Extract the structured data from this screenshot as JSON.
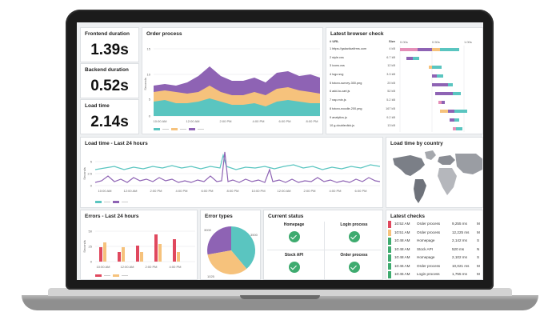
{
  "colors": {
    "teal": "#5ac5c0",
    "orange": "#f6c27c",
    "purple": "#8e63b4",
    "red": "#e0485e",
    "green": "#3eab6f",
    "pink": "#e58fb8",
    "gray": "#a5a8ad"
  },
  "kpis": [
    {
      "label": "Frontend duration",
      "value": "1.39s"
    },
    {
      "label": "Backend duration",
      "value": "0.52s"
    },
    {
      "label": "Load time",
      "value": "2.14s"
    }
  ],
  "order_process": {
    "title": "Order process",
    "ylabel": "Seconds",
    "yticks": [
      "15",
      "10",
      "5",
      "0"
    ],
    "xticks": [
      "10:00 AM",
      "12:00 AM",
      "2:00 PM",
      "4:00 PM",
      "6:00 PM",
      "8:00 PM"
    ]
  },
  "browser_check": {
    "title": "Latest browser check",
    "header": {
      "url": "# URL",
      "size": "Size",
      "t0": "0.00s",
      "t1": "0.50s",
      "t2": "1.00s"
    },
    "rows": [
      {
        "url": "1  https://galacticafirms.com",
        "size": "4 kB"
      },
      {
        "url": "2  style.css",
        "size": "6.7 kB"
      },
      {
        "url": "3  icons.css",
        "size": "12 kB"
      },
      {
        "url": "4  logo.svg",
        "size": "3.3 kB"
      },
      {
        "url": "5  totoro-survey-300.png",
        "size": "20 kB"
      },
      {
        "url": "6  add-to-cart.js",
        "size": "52 kB"
      },
      {
        "url": "7  nap.min.js",
        "size": "5.2 kB"
      },
      {
        "url": "8  totoro-noodle-200.png",
        "size": "167 kB"
      },
      {
        "url": "9  analytics.js",
        "size": "9.2 kB"
      },
      {
        "url": "10  g.doubleclick.js",
        "size": "13 kB"
      }
    ]
  },
  "load_time": {
    "title": "Load time - Last 24 hours",
    "ylabel": "Seconds",
    "yticks": [
      "5",
      "2.5",
      "0"
    ],
    "xticks": [
      "10:00 AM",
      "12:00 AM",
      "2:00 PM",
      "4:00 PM",
      "6:00 PM",
      "8:00 PM",
      "10:00 PM",
      "12:00 AM",
      "2:00 PM",
      "4:00 PM",
      "6:00 PM"
    ]
  },
  "country": {
    "title": "Load time by country"
  },
  "errors": {
    "title": "Errors - Last 24 hours",
    "ylabel": "Seconds",
    "yticks": [
      "50",
      "25",
      "0"
    ],
    "xticks": [
      "10:00 AM",
      "12:00 AM",
      "2:00 PM",
      "4:00 PM"
    ]
  },
  "error_types": {
    "title": "Error types",
    "labels": [
      "3000",
      "3500",
      "1025"
    ]
  },
  "current_status": {
    "title": "Current status",
    "items": [
      "Homepage",
      "Login process",
      "Stock API",
      "Order process"
    ]
  },
  "latest_checks": {
    "title": "Latest checks",
    "rows": [
      {
        "color": "#e0485e",
        "time": "10:52 AM",
        "name": "Order process",
        "ms": "9,255 ms",
        "trunc": "M"
      },
      {
        "color": "#f6c27c",
        "time": "10:51 AM",
        "name": "Order process",
        "ms": "12,225 ms",
        "trunc": "M"
      },
      {
        "color": "#3eab6f",
        "time": "10:48 AM",
        "name": "Homepage",
        "ms": "2,142 ms",
        "trunc": "S"
      },
      {
        "color": "#3eab6f",
        "time": "10:48 AM",
        "name": "Stock API",
        "ms": "520 ms",
        "trunc": "N"
      },
      {
        "color": "#3eab6f",
        "time": "10:48 AM",
        "name": "Homepage",
        "ms": "2,102 ms",
        "trunc": "S"
      },
      {
        "color": "#3eab6f",
        "time": "10:46 AM",
        "name": "Order process",
        "ms": "10,021 ms",
        "trunc": "M"
      },
      {
        "color": "#3eab6f",
        "time": "10:45 AM",
        "name": "Login process",
        "ms": "1,755 ms",
        "trunc": "M"
      }
    ]
  }
}
